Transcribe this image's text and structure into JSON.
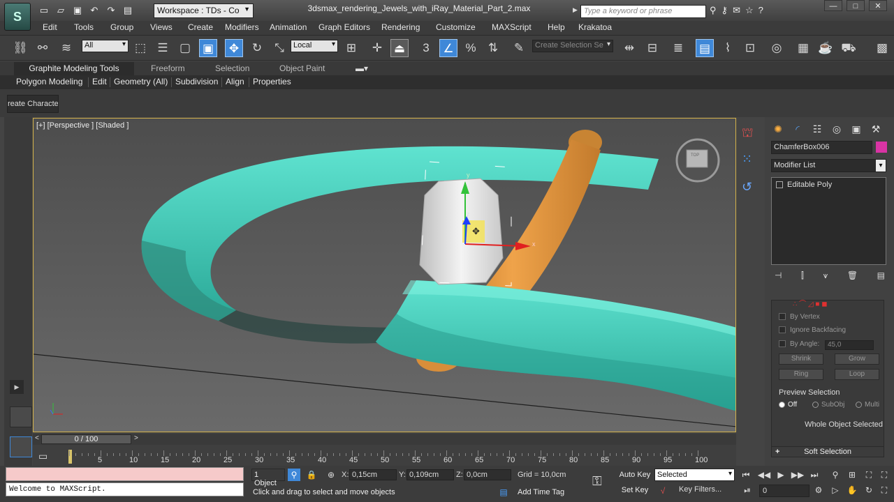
{
  "titlebar": {
    "app_logo": "S",
    "workspace": "Workspace : TDs - Co",
    "doc_title": "3dsmax_rendering_Jewels_with_iRay_Material_Part_2.max",
    "search_placeholder": "Type a keyword or phrase"
  },
  "menu": [
    "Edit",
    "Tools",
    "Group",
    "Views",
    "Create",
    "Modifiers",
    "Animation",
    "Graph Editors",
    "Rendering",
    "Customize",
    "MAXScript",
    "Help",
    "Krakatoa"
  ],
  "toolbar": {
    "selection_filter": "All",
    "ref_coord": "Local",
    "named_selection": "Create Selection Se",
    "snap_label": "3"
  },
  "ribbon": {
    "tabs": [
      "Graphite Modeling Tools",
      "Freeform",
      "Selection",
      "Object Paint"
    ],
    "panels": [
      "Polygon Modeling",
      "Edit",
      "Geometry (All)",
      "Subdivision",
      "Align",
      "Properties"
    ],
    "create_character": "reate Characte"
  },
  "viewport": {
    "label": "[+] [Perspective ] [Shaded ]",
    "viewcube_label": "TOP",
    "gizmo_x": "x",
    "gizmo_y": "y",
    "gizmo_z": "z",
    "colors": {
      "ring": "#3fd0bc",
      "rod": "#d98f3a",
      "box": "#d9d9d9"
    }
  },
  "command_panel": {
    "object_name": "ChamferBox006",
    "object_color": "#d934a4",
    "modifier_list": "Modifier List",
    "stack": [
      "Editable Poly"
    ],
    "selection": {
      "by_vertex": "By Vertex",
      "ignore_backfacing": "Ignore Backfacing",
      "by_angle": "By Angle:",
      "by_angle_value": "45,0",
      "shrink": "Shrink",
      "grow": "Grow",
      "ring": "Ring",
      "loop": "Loop",
      "preview_selection": "Preview Selection",
      "off": "Off",
      "subobj": "SubObj",
      "multi": "Multi",
      "whole_object": "Whole Object Selected"
    },
    "soft_selection": "Soft Selection"
  },
  "timeline": {
    "slider": "0 / 100",
    "ticks": [
      "0",
      "5",
      "10",
      "15",
      "20",
      "25",
      "30",
      "35",
      "40",
      "45",
      "50",
      "55",
      "60",
      "65",
      "70",
      "75",
      "80",
      "85",
      "90",
      "95",
      "100"
    ]
  },
  "status": {
    "maxscript_output": "Welcome to MAXScript.",
    "selection_count": "1 Object",
    "x_label": "X:",
    "x_value": "0,15cm",
    "y_label": "Y:",
    "y_value": "0,109cm",
    "z_label": "Z:",
    "z_value": "0,0cm",
    "grid": "Grid = 10,0cm",
    "prompt": "Click and drag to select and move objects",
    "add_time_tag": "Add Time Tag",
    "auto_key": "Auto Key",
    "set_key": "Set Key",
    "key_mode": "Selected",
    "key_filters": "Key Filters...",
    "current_frame": "0"
  }
}
